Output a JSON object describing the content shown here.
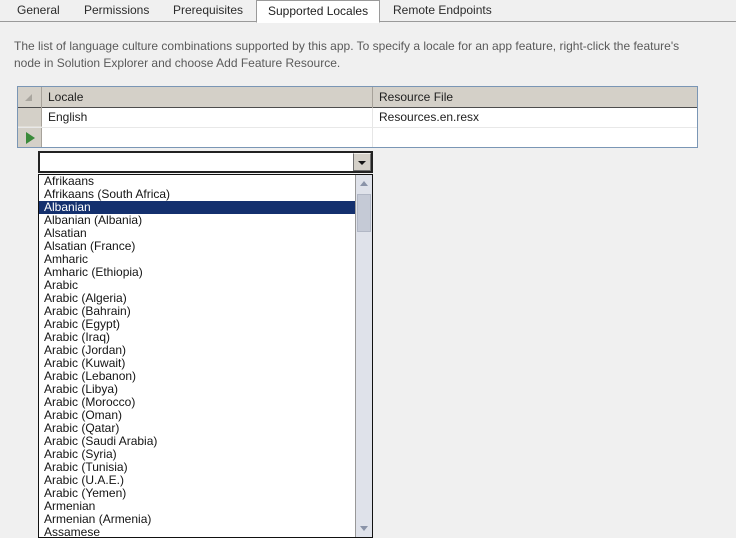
{
  "tabs": [
    {
      "label": "General",
      "selected": false
    },
    {
      "label": "Permissions",
      "selected": false
    },
    {
      "label": "Prerequisites",
      "selected": false
    },
    {
      "label": "Supported Locales",
      "selected": true
    },
    {
      "label": "Remote Endpoints",
      "selected": false
    }
  ],
  "description": "The list of language culture combinations supported by this app. To specify a locale for an app feature, right-click the feature's node in Solution Explorer and choose Add Feature Resource.",
  "grid": {
    "columns": [
      "Locale",
      "Resource File"
    ],
    "rows": [
      {
        "locale": "English",
        "resource_file": "Resources.en.resx",
        "current": false
      },
      {
        "locale": "",
        "resource_file": "",
        "current": true
      }
    ]
  },
  "combo": {
    "value": "",
    "placeholder": "",
    "expanded": true
  },
  "dropdown": {
    "selected": "Albanian",
    "items": [
      "Afrikaans",
      "Afrikaans (South Africa)",
      "Albanian",
      "Albanian (Albania)",
      "Alsatian",
      "Alsatian (France)",
      "Amharic",
      "Amharic (Ethiopia)",
      "Arabic",
      "Arabic (Algeria)",
      "Arabic (Bahrain)",
      "Arabic (Egypt)",
      "Arabic (Iraq)",
      "Arabic (Jordan)",
      "Arabic (Kuwait)",
      "Arabic (Lebanon)",
      "Arabic (Libya)",
      "Arabic (Morocco)",
      "Arabic (Oman)",
      "Arabic (Qatar)",
      "Arabic (Saudi Arabia)",
      "Arabic (Syria)",
      "Arabic (Tunisia)",
      "Arabic (U.A.E.)",
      "Arabic (Yemen)",
      "Armenian",
      "Armenian (Armenia)",
      "Assamese"
    ]
  },
  "colors": {
    "selection": "#14306e",
    "grid_border": "#7a96b5",
    "header_bg": "#d4d0c8",
    "current_row_marker": "#3a8a3a",
    "page_bg": "#f0f0f0"
  }
}
